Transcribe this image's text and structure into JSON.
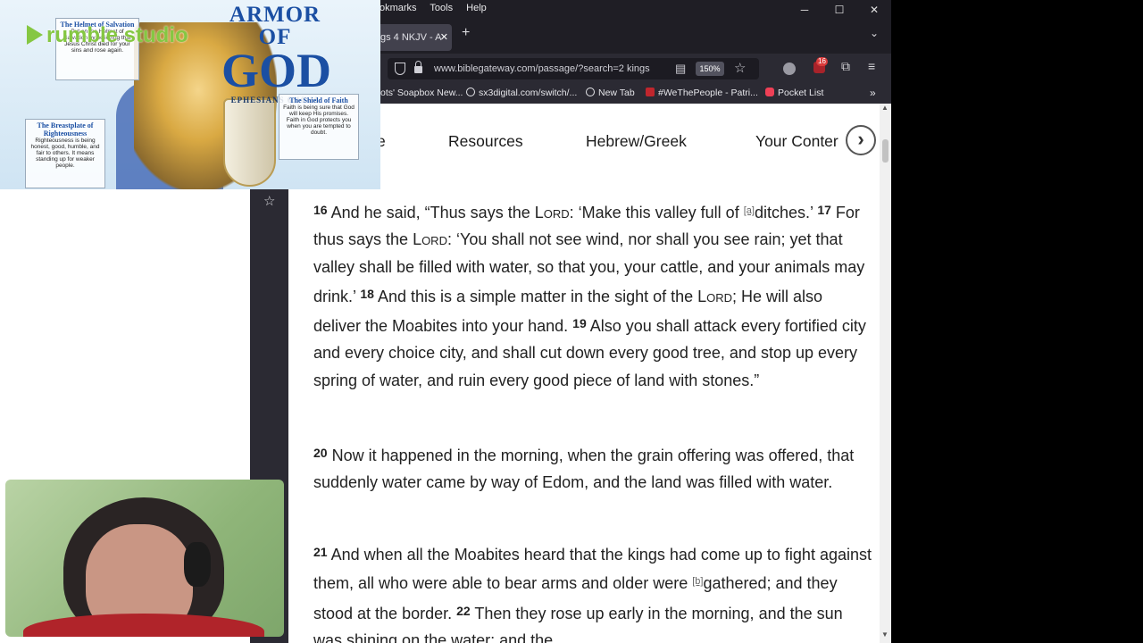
{
  "browser": {
    "menu": [
      "okmarks",
      "Tools",
      "Help"
    ],
    "window_buttons": {
      "minimize": "─",
      "maximize": "☐",
      "close": "✕"
    },
    "tab": {
      "title": "gs 4 NKJV - A",
      "close": "✕"
    },
    "new_tab": "+",
    "tab_list": "⌄",
    "url": "www.biblegateway.com/passage/?search=2 kings",
    "zoom": "150%",
    "notification_count": "16",
    "bookmarks": [
      {
        "label": "ots' Soapbox New..."
      },
      {
        "label": "sx3digital.com/switch/..."
      },
      {
        "label": "New Tab"
      },
      {
        "label": "#WeThePeople - Patri..."
      },
      {
        "label": "Pocket List"
      }
    ],
    "bookmarks_more": "»"
  },
  "resource_nav": {
    "items": [
      "e",
      "Resources",
      "Hebrew/Greek",
      "Your Conter"
    ],
    "next": "›"
  },
  "passage": {
    "p1": {
      "v16": "16",
      "t1": "And he said, “Thus says the ",
      "lord": "Lord",
      "t2": ": ‘Make this valley full of ",
      "fn_a": "[a]",
      "t3": "ditches.’ ",
      "v17": "17",
      "t4": "For thus says the ",
      "t5": ": ‘You shall not see wind, nor shall you see rain; yet that valley shall be filled with water, so that you, your cattle, and your animals may drink.’ ",
      "v18": "18",
      "t6": "And this is a simple matter in the sight of the ",
      "t7": "; He will also deliver the Moabites into your hand. ",
      "v19": "19",
      "t8": "Also you shall attack every fortified city and every choice city, and shall cut down every good tree, and stop up every spring of water, and ruin every good piece of land with stones.”"
    },
    "p2": {
      "v20": "20",
      "t1": "Now it happened in the morning, when the grain offering was offered, that suddenly water came by way of Edom, and the land was filled with water."
    },
    "p3": {
      "v21": "21",
      "t1": "And when all the Moabites heard that the kings had come up to fight against them, all who were able to bear arms and older were ",
      "fn_b": "[b]",
      "t2": "gathered; and they stood at the border. ",
      "v22": "22",
      "t3": "Then they rose up early in the morning, and the sun was shining on the water; and the"
    }
  },
  "overlay": {
    "brand": "rumble studio",
    "armor_title_1": "ARMOR OF",
    "armor_title_2": "GOD",
    "armor_ref": "EPHESIANS 6:10-18",
    "helmet": {
      "title": "The Helmet of Salvation",
      "text": "Put on the Helmet of Salvation by believing that Jesus Christ died for your sins and rose again."
    },
    "shield": {
      "title": "The Shield of Faith",
      "text": "Faith is being sure that God will keep His promises. Faith in God protects you when you are tempted to doubt."
    },
    "breastplate": {
      "title": "The Breastplate of Righteousness",
      "text": "Righteousness is being honest, good, humble, and fair to others. It means standing up for weaker people."
    }
  }
}
